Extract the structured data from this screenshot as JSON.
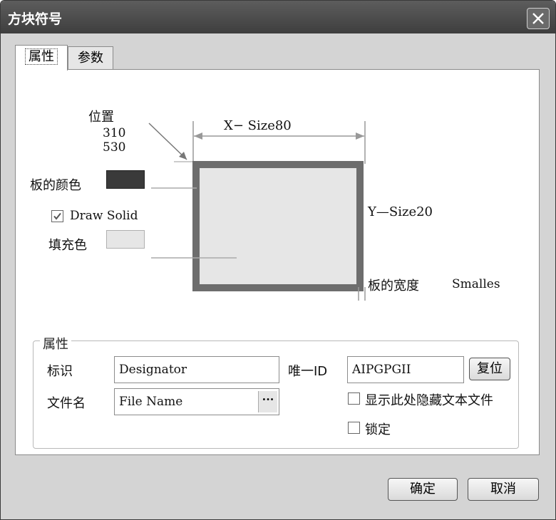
{
  "window": {
    "title": "方块符号"
  },
  "tabs": [
    {
      "label": "属性",
      "active": true
    },
    {
      "label": "参数",
      "active": false
    }
  ],
  "preview": {
    "position_label": "位置",
    "position_x": "310",
    "position_y": "530",
    "x_size_label": "X− Size",
    "x_size_value": "80",
    "y_size_label": "Y—Size",
    "y_size_value": "20",
    "border_color_label": "板的颜色",
    "border_color": "#3a3a3a",
    "draw_solid_label": "Draw Solid",
    "draw_solid_checked": true,
    "fill_color_label": "填充色",
    "fill_color": "#e6e6e6",
    "border_width_label": "板的宽度",
    "border_width_value": "Smalles"
  },
  "properties": {
    "group_title": "属性",
    "designator_label": "标识",
    "designator_value": "Designator",
    "unique_id_label": "唯一ID",
    "unique_id_value": "AIPGPGII",
    "reset_label": "复位",
    "filename_label": "文件名",
    "filename_value": "File Name",
    "ellipsis": "···",
    "show_hidden_label": "显示此处隐藏文本文件",
    "show_hidden_checked": false,
    "lock_label": "锁定",
    "lock_checked": false
  },
  "footer": {
    "ok_label": "确定",
    "cancel_label": "取消"
  }
}
